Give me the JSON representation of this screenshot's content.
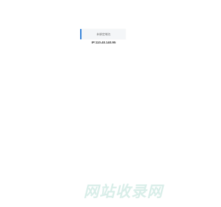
{
  "notice": {
    "text": "未绑定域名"
  },
  "ip": {
    "label": "IP:110.40.140.95"
  },
  "watermark": {
    "text": "网站收录网",
    "color": "#d9eee9"
  },
  "colors": {
    "accent": "#2f7fd8",
    "background": "#ffffff",
    "box_background": "#f4f6f8"
  }
}
